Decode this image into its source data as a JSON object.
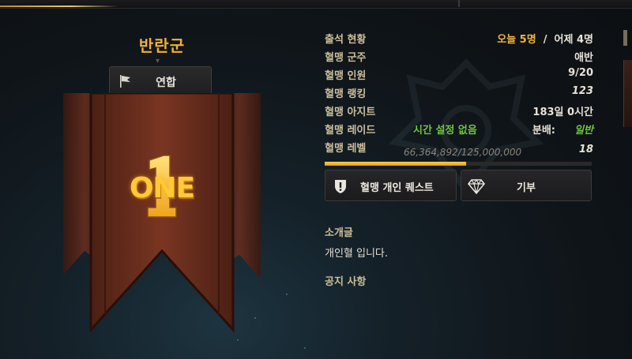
{
  "guild": {
    "name": "반란군",
    "alliance_label": "연합",
    "rank_text": "ONE"
  },
  "info": {
    "attendance": {
      "label": "출석 현황",
      "today": "오늘 5명",
      "sep": "/",
      "yesterday": "어제 4명"
    },
    "leader": {
      "label": "혈맹 군주",
      "value": "애반"
    },
    "members": {
      "label": "혈맹 인원",
      "value": "9/20"
    },
    "ranking": {
      "label": "혈맹 랭킹",
      "value": "123"
    },
    "hideout": {
      "label": "혈맹 아지트",
      "value": "183일 0시간"
    },
    "raid": {
      "label": "혈맹 레이드",
      "time": "시간 설정 없음",
      "dist_label": "분배:",
      "dist_value": "일반"
    },
    "level": {
      "label": "혈맹 레벨",
      "exp": "66,364,892/125,000,000",
      "value": "18",
      "progress": 0.531
    }
  },
  "buttons": {
    "quest": "혈맹 개인 퀘스트",
    "donate": "기부"
  },
  "intro": {
    "title": "소개글",
    "text": "개인혈 입니다."
  },
  "notice": {
    "title": "공지 사항"
  },
  "colors": {
    "accent_gold": "#f3b43a",
    "green": "#6fc63e",
    "banner": "#5c2a1c"
  },
  "icons": {
    "alliance": "flag-icon",
    "quest": "shield-exclamation-icon",
    "donate": "gem-icon"
  }
}
